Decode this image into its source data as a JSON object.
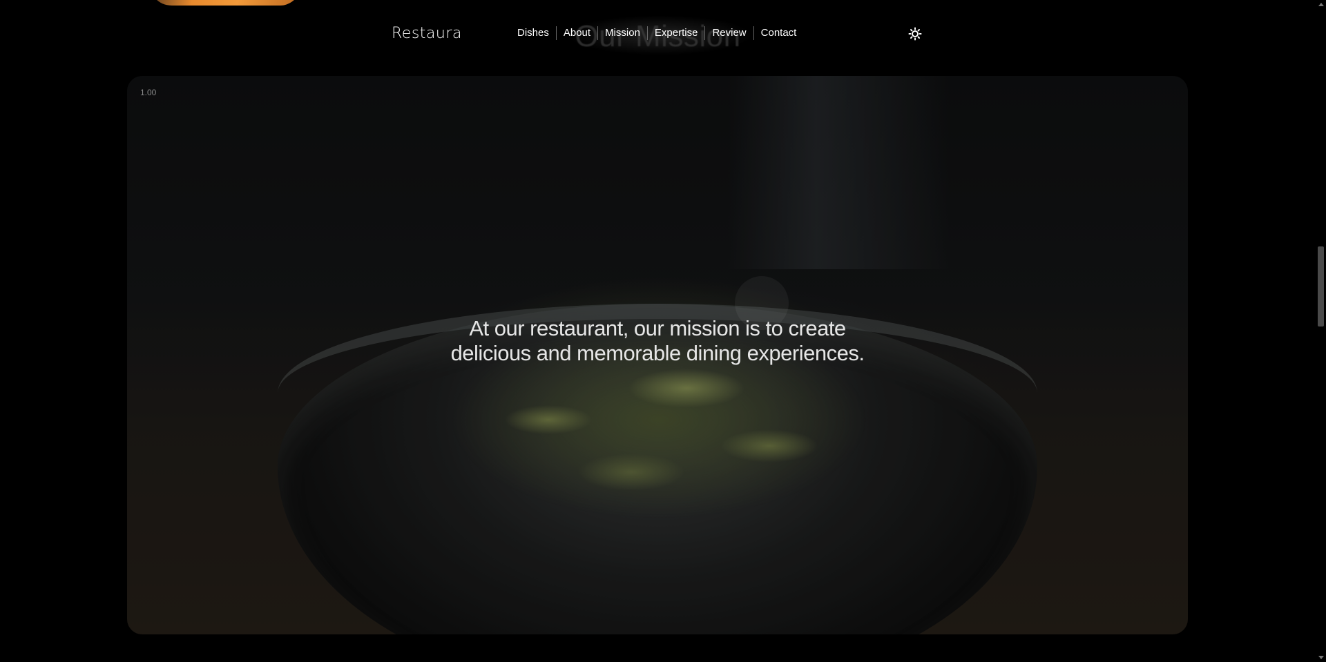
{
  "nav": {
    "logo": "Restaura",
    "links": [
      "Dishes",
      "About",
      "Mission",
      "Expertise",
      "Review",
      "Contact"
    ],
    "theme_toggle_icon": "sun-icon"
  },
  "section": {
    "title": "Our Mission"
  },
  "mission_card": {
    "counter": "1.00",
    "text": "At our restaurant, our mission is to create delicious and memorable dining experiences."
  },
  "colors": {
    "background": "#000000",
    "text": "#ffffff"
  }
}
